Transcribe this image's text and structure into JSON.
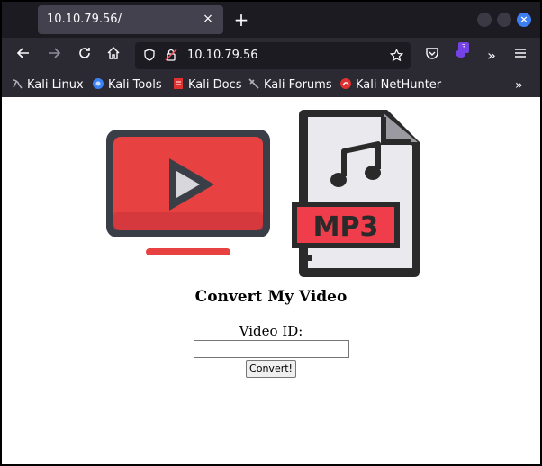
{
  "browser": {
    "tab_title": "10.10.79.56/",
    "tab_close_glyph": "×",
    "new_tab_glyph": "+",
    "url": "10.10.79.56",
    "extension_badge": "3",
    "bookmarks": [
      {
        "label": "Kali Linux",
        "icon": "kali-dragon-icon",
        "color": "#9aa0a6"
      },
      {
        "label": "Kali Tools",
        "icon": "kali-tools-icon",
        "color": "#3b82f6"
      },
      {
        "label": "Kali Docs",
        "icon": "kali-docs-icon",
        "color": "#e03131"
      },
      {
        "label": "Kali Forums",
        "icon": "kali-forums-icon",
        "color": "#9aa0a6"
      },
      {
        "label": "Kali NetHunter",
        "icon": "nethunter-icon",
        "color": "#e03131"
      }
    ],
    "more_glyph": "»"
  },
  "page": {
    "heading": "Convert My Video",
    "video_id_label": "Video ID:",
    "video_id_value": "",
    "convert_button": "Convert!",
    "mp3_label": "MP3"
  },
  "colors": {
    "youtube_red": "#e84141",
    "file_outline": "#2a2a2a",
    "mp3_banner": "#ef3d4c"
  }
}
